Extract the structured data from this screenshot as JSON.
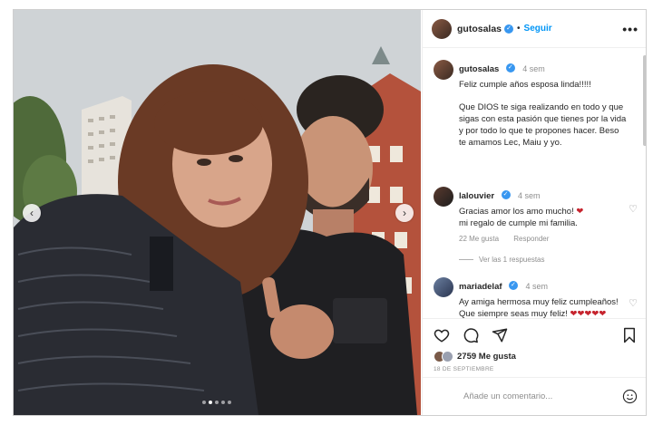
{
  "post": {
    "username": "gutosalas",
    "separator": "•",
    "follow_label": "Seguir",
    "more_label": "•••"
  },
  "comments": [
    {
      "username": "gutosalas",
      "time": "4 sem",
      "paragraphs": [
        "Feliz cumple años esposa linda!!!!!",
        "Que DIOS te siga realizando en todo y que sigas con esta pasión que tienes por la vida y por todo lo que te propones hacer. Beso te amamos Lec, Maiu y yo."
      ]
    },
    {
      "username": "lalouvier",
      "time": "4 sem",
      "text": "Gracias amor los amo mucho!",
      "heart": "❤",
      "text2": "mi regalo de cumple mi familia.",
      "likes": "22 Me gusta",
      "reply": "Responder",
      "view_replies": "Ver las 1 respuestas"
    },
    {
      "username": "mariadelaf",
      "time": "4 sem",
      "text": "Ay amiga hermosa muy feliz cumpleaños! Que siempre seas muy feliz!",
      "hearts": "❤❤❤❤❤"
    }
  ],
  "actions": {
    "likes_count": "2759",
    "likes_label": "Me gusta",
    "date": "18 DE SEPTIEMBRE"
  },
  "composer": {
    "placeholder": "Añade un comentario..."
  },
  "icons": {
    "like": "heart-icon",
    "comment": "comment-icon",
    "share": "share-icon",
    "save": "bookmark-icon",
    "emoji": "emoji-icon",
    "verified": "verified-icon"
  },
  "colors": {
    "link_blue": "#0095f6",
    "verified_blue": "#3897f0",
    "muted": "#8e8e8e",
    "heart_red": "#c6242e"
  },
  "carousel": {
    "slides": 5,
    "active_index": 1
  }
}
